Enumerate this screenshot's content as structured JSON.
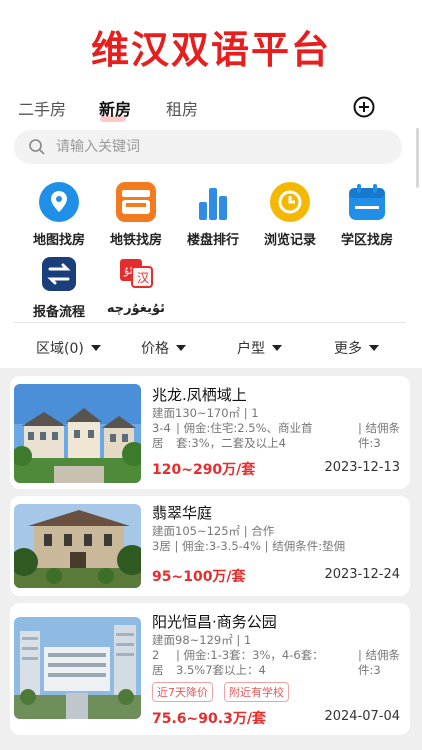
{
  "banner": {
    "title": "维汉双语平台"
  },
  "tabs": [
    {
      "label": "二手房"
    },
    {
      "label": "新房"
    },
    {
      "label": "租房"
    }
  ],
  "search": {
    "placeholder": "请输入关键词"
  },
  "menu": [
    {
      "label": "地图找房",
      "icon": "map-pin-icon",
      "color": "#1f8fe8"
    },
    {
      "label": "地铁找房",
      "icon": "metro-icon",
      "color": "#f47a20"
    },
    {
      "label": "楼盘排行",
      "icon": "bar-chart-icon",
      "color": "#2e8be6"
    },
    {
      "label": "浏览记录",
      "icon": "clock-icon",
      "color": "#f5b800"
    },
    {
      "label": "学区找房",
      "icon": "calendar-icon",
      "color": "#1f8fe8"
    },
    {
      "label": "报备流程",
      "icon": "exchange-icon",
      "color": "#1a3d7c"
    },
    {
      "label": "ئۇيغۇرچە",
      "icon": "language-icon",
      "color": "#e62d2d"
    }
  ],
  "filters": [
    {
      "label": "区域(0)"
    },
    {
      "label": "价格"
    },
    {
      "label": "户型"
    },
    {
      "label": "更多"
    }
  ],
  "listings": [
    {
      "title": "兆龙.凤栖域上",
      "line1": "建面130~170㎡ | 1",
      "col_a": "3-4\n居",
      "col_b": "| 佣金:住宅:2.5%、商业首\n套:3%，二套及以上4",
      "col_c": "| 结佣条\n件:3",
      "price": "120~290万/套",
      "date": "2023-12-13"
    },
    {
      "title": "翡翠华庭",
      "line1": "建面105~125㎡ | 合作",
      "line2": "3居 | 佣金:3-3.5-4% | 结佣条件:垫佣",
      "price": "95~100万/套",
      "date": "2023-12-24"
    },
    {
      "title": "阳光恒昌·商务公园",
      "line1": "建面98~129㎡ | 1",
      "col_a": "2\n居",
      "col_b": "| 佣金:1-3套：3%，4-6套：\n3.5%7套以上：4",
      "col_c": "| 结佣条\n件:3",
      "tags": [
        "近7天降价",
        "附近有学校"
      ],
      "price": "75.6~90.3万/套",
      "date": "2024-07-04"
    }
  ]
}
